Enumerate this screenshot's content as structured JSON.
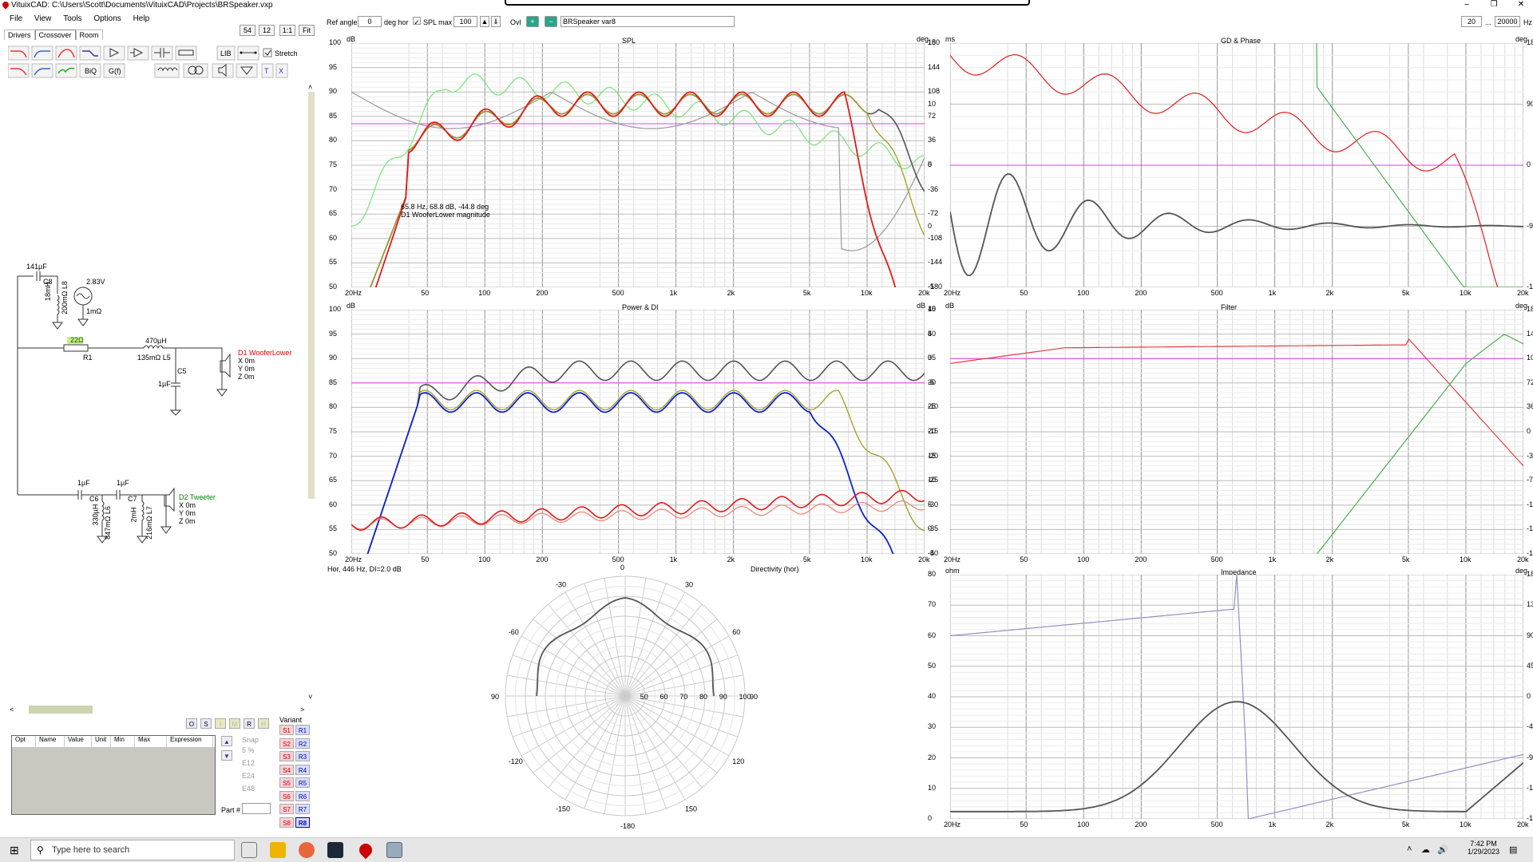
{
  "app": {
    "title": "VituixCAD: C:\\Users\\Scott\\Documents\\VituixCAD\\Projects\\BRSpeaker.vxp"
  },
  "menu": [
    "File",
    "View",
    "Tools",
    "Options",
    "Help"
  ],
  "toolbar": {
    "btn54": "54",
    "btn12": "12",
    "btn11": "1:1",
    "fit": "Fit",
    "ref_angle_label": "Ref angle",
    "ref_angle_value": "0",
    "deg_hor": "deg hor",
    "spl_max_label": "SPL max",
    "spl_max_value": "100",
    "ovl": "Ovl",
    "variant_name": "BRSpeaker var8",
    "freq_min": "20",
    "freq_max": "20000",
    "hz": "Hz"
  },
  "tabs": [
    "Drivers",
    "Crossover",
    "Room"
  ],
  "tools": {
    "lib": "LIB",
    "stretch": "Stretch",
    "biq": "BiQ",
    "gf": "G(f)",
    "t": "T",
    "x": "X"
  },
  "schematic": {
    "c8_top": "141µF",
    "c8": "C8",
    "l8": "18mH",
    "l8b": "200mΩ L8",
    "src_v": "2.83V",
    "src_r": "1mΩ",
    "r1_val": "22Ω",
    "r1": "R1",
    "l5_val": "470µH",
    "l5_r": "135mΩ L5",
    "c5": "C5",
    "c5_val": "1µF",
    "d1_name": "D1 WooferLower",
    "d1_x": "X 0m",
    "d1_y": "Y 0m",
    "d1_z": "Z 0m",
    "c6_val": "1µF",
    "c6": "C6",
    "c7_val": "1µF",
    "c7": "C7",
    "l6_val": "330µH",
    "l6_r": "847mΩ L6",
    "l7_val": "2mH",
    "l7_r": "216mΩ L7",
    "d2_name": "D2 Tweeter",
    "d2_x": "X 0m",
    "d2_y": "Y 0m",
    "d2_z": "Z 0m"
  },
  "part_table": {
    "headers": [
      "Opt",
      "Name",
      "Value",
      "Unit",
      "Min",
      "Max",
      "Expression"
    ],
    "osimrh": [
      "O",
      "S",
      "I",
      "M",
      "R",
      "H"
    ],
    "snap": "Snap",
    "snap_opts": [
      "5 %",
      "E12",
      "E24",
      "E48"
    ],
    "part_no": "Part #"
  },
  "variant": {
    "label": "Variant",
    "s": [
      "S1",
      "S2",
      "S3",
      "S4",
      "S5",
      "S6",
      "S7",
      "S8"
    ],
    "r": [
      "R1",
      "R2",
      "R3",
      "R4",
      "R5",
      "R6",
      "R7",
      "R8"
    ]
  },
  "colors": {
    "red": "#e31a1c",
    "green": "#4caf50",
    "lightgreen": "#76e476",
    "gray": "#555555",
    "blue": "#1020d0",
    "magenta": "#e040e0",
    "olive": "#a0a020"
  },
  "freq_ticks": [
    "20Hz",
    "50",
    "100",
    "200",
    "500",
    "1k",
    "2k",
    "5k",
    "10k",
    "20k"
  ],
  "spl": {
    "title": "SPL",
    "unit_l": "dB",
    "unit_r": "deg",
    "yl": [
      "100",
      "95",
      "90",
      "85",
      "80",
      "75",
      "70",
      "65",
      "60",
      "55",
      "50"
    ],
    "yr": [
      "180",
      "144",
      "108",
      "72",
      "36",
      "0",
      "-36",
      "-72",
      "-108",
      "-144",
      "-180"
    ],
    "tooltip1": "65.8 Hz, 68.8 dB, -44.8 deg",
    "tooltip2": "D1 WooferLower magnitude"
  },
  "gd": {
    "title": "GD & Phase",
    "unit_l": "ms",
    "unit_r": "deg",
    "yl": [
      "15",
      "10",
      "5",
      "0",
      "-5"
    ],
    "yr": [
      "180",
      "90",
      "0",
      "-90",
      "-180"
    ]
  },
  "power": {
    "title": "Power & DI",
    "unit_l": "dB",
    "unit_r": "dB",
    "yl": [
      "100",
      "95",
      "90",
      "85",
      "80",
      "75",
      "70",
      "65",
      "60",
      "55",
      "50"
    ],
    "yr": [
      "45",
      "40",
      "35",
      "30",
      "25",
      "20",
      "15",
      "10",
      "5",
      "0",
      "-5"
    ]
  },
  "filter": {
    "title": "Filter",
    "unit_l": "dB",
    "unit_r": "deg",
    "yl": [
      "10",
      "5",
      "0",
      "-5",
      "-10",
      "-15",
      "-20",
      "-25",
      "-30",
      "-35",
      "-40"
    ],
    "yr": [
      "180",
      "144",
      "108",
      "72",
      "36",
      "0",
      "-36",
      "-72",
      "-108",
      "-144",
      "-180"
    ]
  },
  "directivity": {
    "title": "Directivity (hor)",
    "status": "Hor, 446 Hz, DI=2.0 dB",
    "angles": [
      "0",
      "30",
      "-30",
      "60",
      "-60",
      "90",
      "90",
      "120",
      "-120",
      "150",
      "-150",
      "-180"
    ],
    "rings": [
      "50",
      "60",
      "70",
      "80",
      "90",
      "100"
    ]
  },
  "impedance": {
    "title": "Impedance",
    "unit_l": "ohm",
    "unit_r": "deg",
    "yl": [
      "80",
      "70",
      "60",
      "50",
      "40",
      "30",
      "20",
      "10",
      "0"
    ],
    "yr": [
      "180",
      "135",
      "90",
      "45",
      "0",
      "-45",
      "-90",
      "-135",
      "-180"
    ]
  },
  "taskbar": {
    "search": "Type here to search",
    "time": "7:42 PM",
    "date": "1/29/2023"
  }
}
